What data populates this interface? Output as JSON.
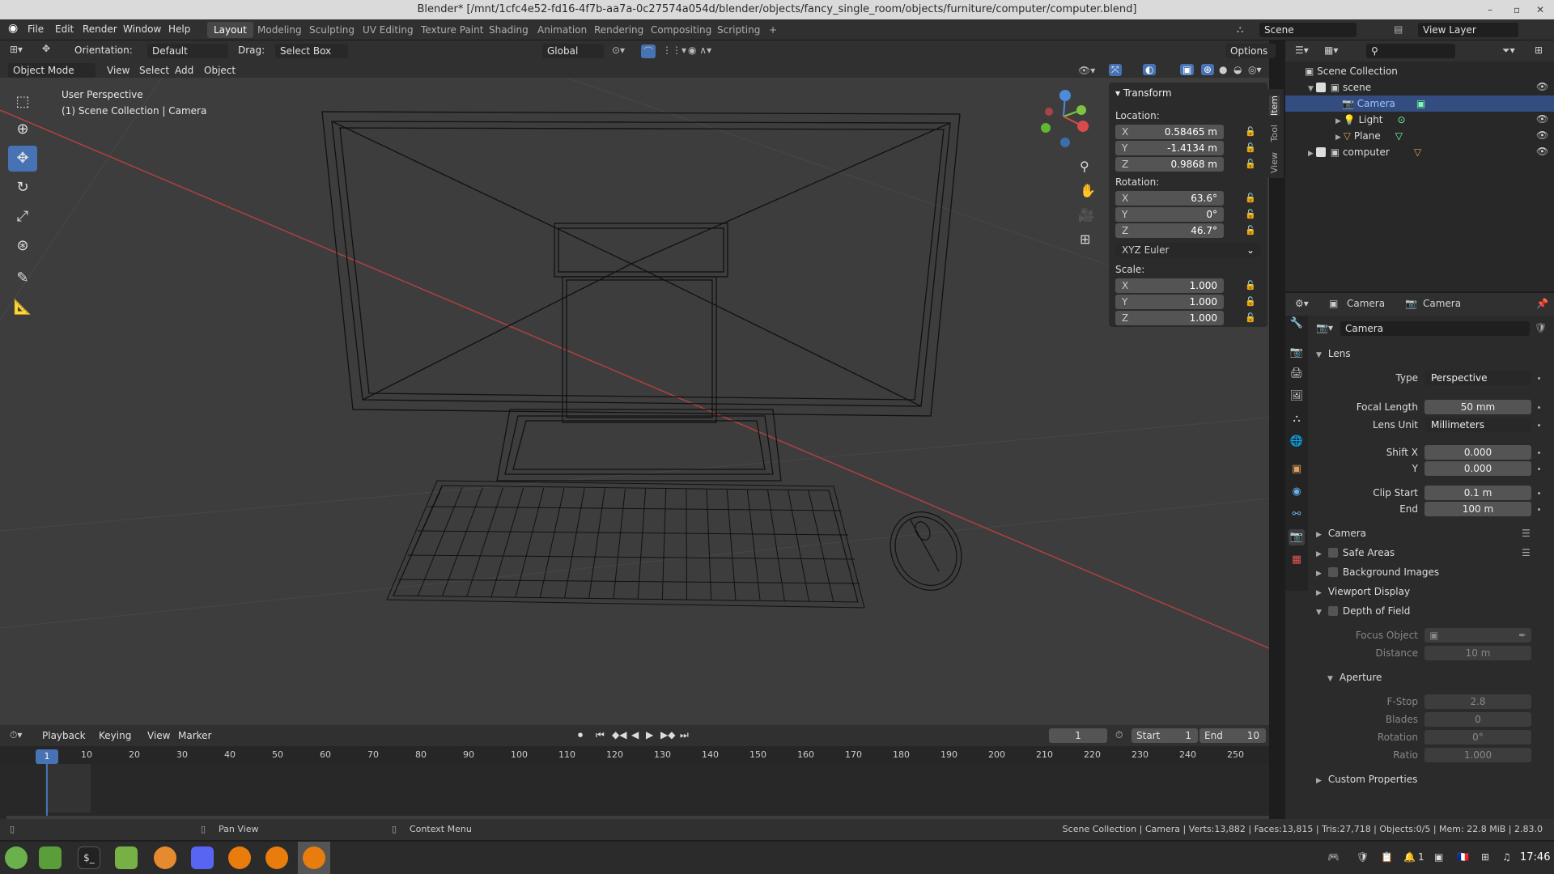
{
  "window": {
    "title": "Blender* [/mnt/1cfc4e52-fd16-4f7b-aa7a-0c27574a054d/blender/objects/fancy_single_room/objects/furniture/computer/computer.blend]",
    "controls": [
      "–",
      "▫",
      "✕"
    ]
  },
  "menu": [
    "File",
    "Edit",
    "Render",
    "Window",
    "Help"
  ],
  "workspaces": [
    "Layout",
    "Modeling",
    "Sculpting",
    "UV Editing",
    "Texture Paint",
    "Shading",
    "Animation",
    "Rendering",
    "Compositing",
    "Scripting",
    "+"
  ],
  "scene_name": "Scene",
  "view_layer": "View Layer",
  "viewport_header": {
    "orientation_label": "Orientation:",
    "orientation_value": "Default",
    "drag_label": "Drag:",
    "drag_value": "Select Box",
    "transform_orientation": "Global",
    "options": "Options",
    "mode": "Object Mode",
    "menus": [
      "View",
      "Select",
      "Add",
      "Object"
    ]
  },
  "viewport_overlay": {
    "perspective": "User Perspective",
    "collection": "(1) Scene Collection | Camera"
  },
  "npanel": {
    "header": "Transform",
    "location_label": "Location:",
    "location": [
      {
        "axis": "X",
        "value": "0.58465 m"
      },
      {
        "axis": "Y",
        "value": "-1.4134 m"
      },
      {
        "axis": "Z",
        "value": "0.9868 m"
      }
    ],
    "rotation_label": "Rotation:",
    "rotation": [
      {
        "axis": "X",
        "value": "63.6°"
      },
      {
        "axis": "Y",
        "value": "0°"
      },
      {
        "axis": "Z",
        "value": "46.7°"
      }
    ],
    "rotation_mode": "XYZ Euler",
    "scale_label": "Scale:",
    "scale": [
      {
        "axis": "X",
        "value": "1.000"
      },
      {
        "axis": "Y",
        "value": "1.000"
      },
      {
        "axis": "Z",
        "value": "1.000"
      }
    ],
    "tabs": [
      "Item",
      "Tool",
      "View"
    ]
  },
  "outliner": {
    "root": "Scene Collection",
    "items": [
      {
        "name": "scene",
        "depth": 1
      },
      {
        "name": "Camera",
        "depth": 2,
        "selected": true
      },
      {
        "name": "Light",
        "depth": 2
      },
      {
        "name": "Plane",
        "depth": 2
      },
      {
        "name": "computer",
        "depth": 1
      }
    ]
  },
  "properties": {
    "breadcrumb_object": "Camera",
    "breadcrumb_data": "Camera",
    "datablock": "Camera",
    "lens_section": "Lens",
    "type_label": "Type",
    "type_value": "Perspective",
    "focal_label": "Focal Length",
    "focal_value": "50 mm",
    "lens_unit_label": "Lens Unit",
    "lens_unit_value": "Millimeters",
    "shiftx_label": "Shift X",
    "shiftx_value": "0.000",
    "shifty_label": "Y",
    "shifty_value": "0.000",
    "clip_start_label": "Clip Start",
    "clip_start_value": "0.1 m",
    "clip_end_label": "End",
    "clip_end_value": "100 m",
    "sections": [
      "Camera",
      "Safe Areas",
      "Background Images",
      "Viewport Display",
      "Depth of Field"
    ],
    "focus_object_label": "Focus Object",
    "distance_label": "Distance",
    "distance_value": "10 m",
    "aperture_section": "Aperture",
    "fstop_label": "F-Stop",
    "fstop_value": "2.8",
    "blades_label": "Blades",
    "blades_value": "0",
    "rotation_label": "Rotation",
    "rotation_value": "0°",
    "ratio_label": "Ratio",
    "ratio_value": "1.000",
    "custom_props": "Custom Properties"
  },
  "timeline": {
    "menus": [
      "Playback",
      "Keying",
      "View",
      "Marker"
    ],
    "current_frame": "1",
    "start_label": "Start",
    "start_value": "1",
    "end_label": "End",
    "end_value": "10",
    "ruler": [
      "1",
      "10",
      "20",
      "30",
      "40",
      "50",
      "60",
      "70",
      "80",
      "90",
      "100",
      "110",
      "120",
      "130",
      "140",
      "150",
      "160",
      "170",
      "180",
      "190",
      "200",
      "210",
      "220",
      "230",
      "240",
      "250"
    ]
  },
  "statusbar": {
    "pan": "Pan View",
    "context": "Context Menu",
    "stats": "Scene Collection | Camera | Verts:13,882 | Faces:13,815 | Tris:27,718 | Objects:0/5 | Mem: 22.8 MiB | 2.83.0"
  },
  "taskbar": {
    "clock": "17:46",
    "workspace_num": "1"
  },
  "colors": {
    "accent": "#4772b3",
    "selected_row": "#334d80",
    "axis_x": "#d94b4b",
    "axis_y": "#7fc241",
    "axis_z": "#4b8bd9"
  }
}
